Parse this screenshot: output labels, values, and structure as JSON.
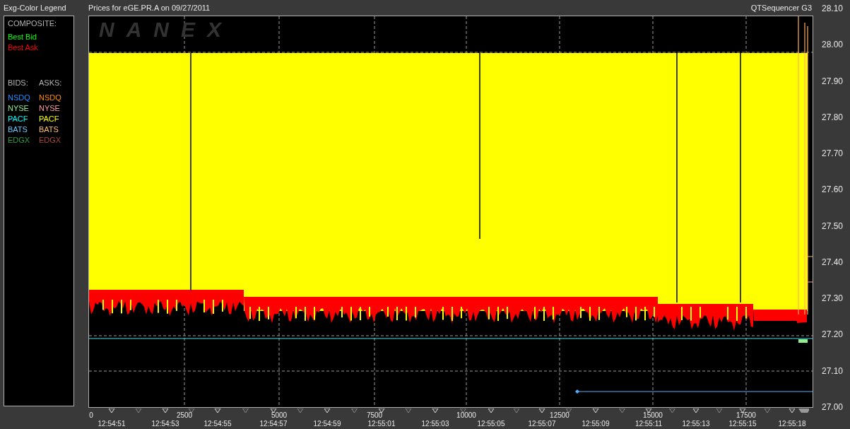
{
  "legend": {
    "title": "Exg-Color Legend",
    "composite_heading": "COMPOSITE:",
    "composite": [
      {
        "label": "Best Bid",
        "color": "#00ff00"
      },
      {
        "label": "Best Ask",
        "color": "#ff0000"
      }
    ],
    "bids_heading": "BIDS:",
    "asks_heading": "ASKS:",
    "exchanges": [
      {
        "bid": {
          "label": "NSDQ",
          "color": "#1e90ff"
        },
        "ask": {
          "label": "NSDQ",
          "color": "#ff8c00"
        }
      },
      {
        "bid": {
          "label": "NYSE",
          "color": "#90ee90"
        },
        "ask": {
          "label": "NYSE",
          "color": "#ff9c9c"
        }
      },
      {
        "bid": {
          "label": "PACF",
          "color": "#00ffff"
        },
        "ask": {
          "label": "PACF",
          "color": "#ffff00"
        }
      },
      {
        "bid": {
          "label": "BATS",
          "color": "#66c8ff"
        },
        "ask": {
          "label": "BATS",
          "color": "#ffc060"
        }
      },
      {
        "bid": {
          "label": "EDGX",
          "color": "#2e9e3e"
        },
        "ask": {
          "label": "EDGX",
          "color": "#a8483a"
        }
      }
    ]
  },
  "chart": {
    "title": "Prices for  eGE.PR.A  on  09/27/2011",
    "source": "QTSequencer G3",
    "watermark": "NANEX",
    "y_ticks": [
      "28.10",
      "28.00",
      "27.90",
      "27.80",
      "27.70",
      "27.60",
      "27.50",
      "27.40",
      "27.30",
      "27.20",
      "27.10",
      "27.00"
    ],
    "x_ticks": [
      "0",
      "2500",
      "5000",
      "7500",
      "10000",
      "12500",
      "15000",
      "17500"
    ],
    "time_ticks": [
      "12:54:51",
      "12:54:53",
      "12:54:55",
      "12:54:57",
      "12:54:59",
      "12:55:01",
      "12:55:03",
      "12:55:05",
      "12:55:07",
      "12:55:09",
      "12:55:11",
      "12:55:13",
      "12:55:15",
      "12:55:18"
    ]
  }
}
